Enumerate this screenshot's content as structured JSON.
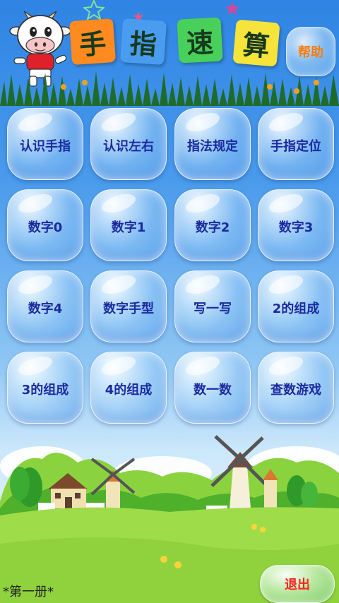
{
  "header": {
    "title_chars": [
      "手",
      "指",
      "速",
      "算"
    ],
    "title_colors": [
      "#ff8a1f",
      "#4a9cf0",
      "#49d05a",
      "#f6e43a"
    ],
    "help_label": "帮助"
  },
  "grid": {
    "rows": [
      [
        "认识手指",
        "认识左右",
        "指法规定",
        "手指定位"
      ],
      [
        "数字0",
        "数字1",
        "数字2",
        "数字3"
      ],
      [
        "数字4",
        "数字手型",
        "写一写",
        "2的组成"
      ],
      [
        "3的组成",
        "4的组成",
        "数一数",
        "查数游戏"
      ]
    ]
  },
  "footer": {
    "book_label": "*第一册*",
    "exit_label": "退出"
  },
  "colors": {
    "button_text": "#1b2aa0",
    "help_text": "#ff7a00",
    "exit_text": "#ff2020"
  }
}
